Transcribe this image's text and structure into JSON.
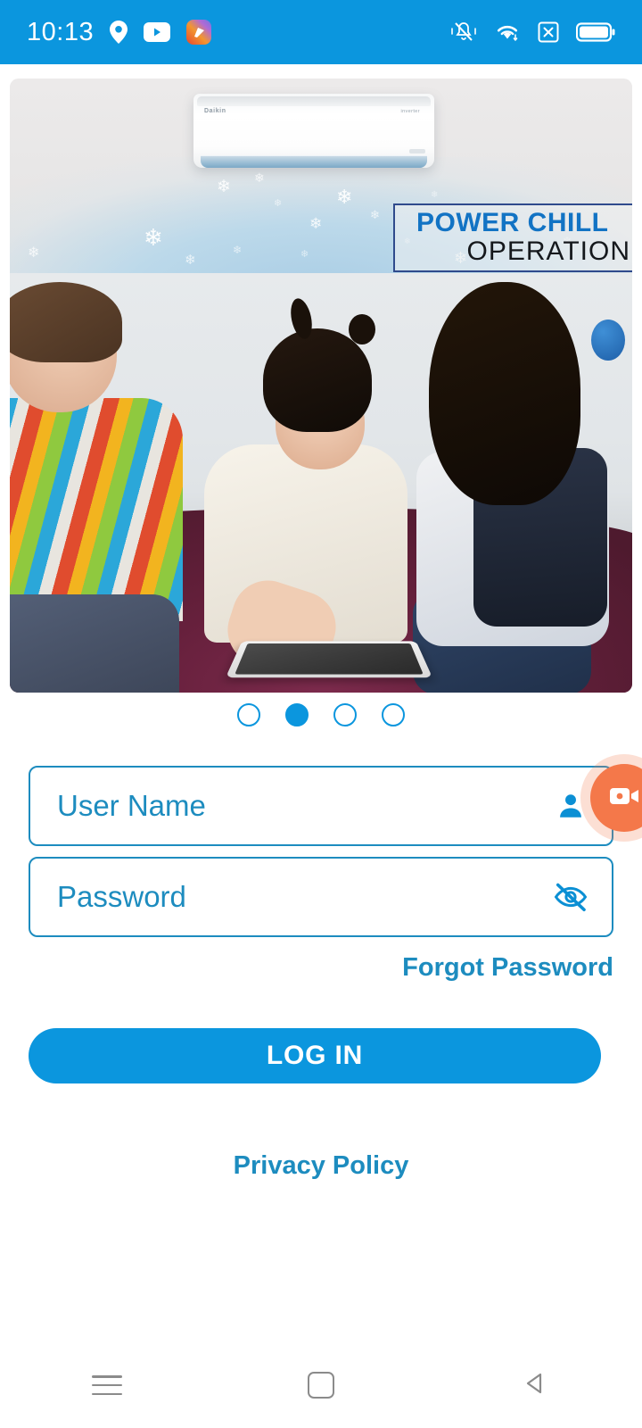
{
  "statusbar": {
    "time": "10:13",
    "left_icons": [
      "location-pin-icon",
      "youtube-icon",
      "app-badge-icon"
    ],
    "right_icons": [
      "vibrate-bell-icon",
      "wifi-icon",
      "no-sim-icon",
      "battery-icon"
    ],
    "background_color": "#0b96de"
  },
  "banner": {
    "headline": "POWER CHILL",
    "subline": "OPERATION",
    "brand": "Daikin",
    "brand_sub": "inverter",
    "headline_color": "#1273c4",
    "subline_color": "#15181c"
  },
  "carousel": {
    "total": 4,
    "active_index": 1
  },
  "form": {
    "username": {
      "placeholder": "User Name",
      "value": "",
      "icon": "person-icon"
    },
    "password": {
      "placeholder": "Password",
      "value": "",
      "icon": "eye-off-icon"
    },
    "forgot_password_label": "Forgot Password",
    "login_label": "LOG IN",
    "privacy_label": "Privacy Policy",
    "accent_color": "#0b96de",
    "field_border_color": "#1d8cbf"
  },
  "floating": {
    "record_button": "video-record-icon",
    "color": "#f4784a"
  },
  "navbar": {
    "recents_label": "recents-icon",
    "home_label": "home-icon",
    "back_label": "back-icon"
  }
}
